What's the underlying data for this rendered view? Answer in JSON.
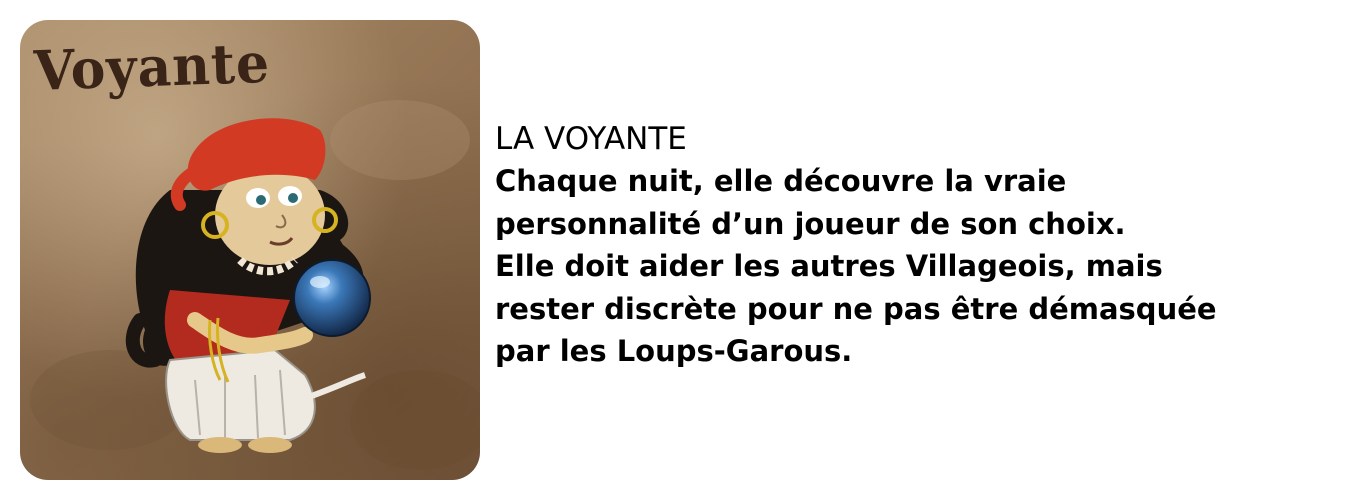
{
  "card": {
    "title": "Voyante",
    "illustration_icon": "fortune-teller-with-crystal-ball",
    "colors": {
      "background": "#9a7b5a",
      "title_ink": "#3a2418",
      "headscarf": "#d23a24",
      "crystal_ball": "#2d5f9a"
    }
  },
  "description": {
    "title": "LA VOYANTE",
    "lines": [
      "Chaque nuit, elle découvre la vraie",
      "personnalité d’un joueur de son choix.",
      "Elle doit aider les autres Villageois, mais",
      "rester discrète pour ne pas être démasquée",
      "par les Loups-Garous."
    ]
  }
}
